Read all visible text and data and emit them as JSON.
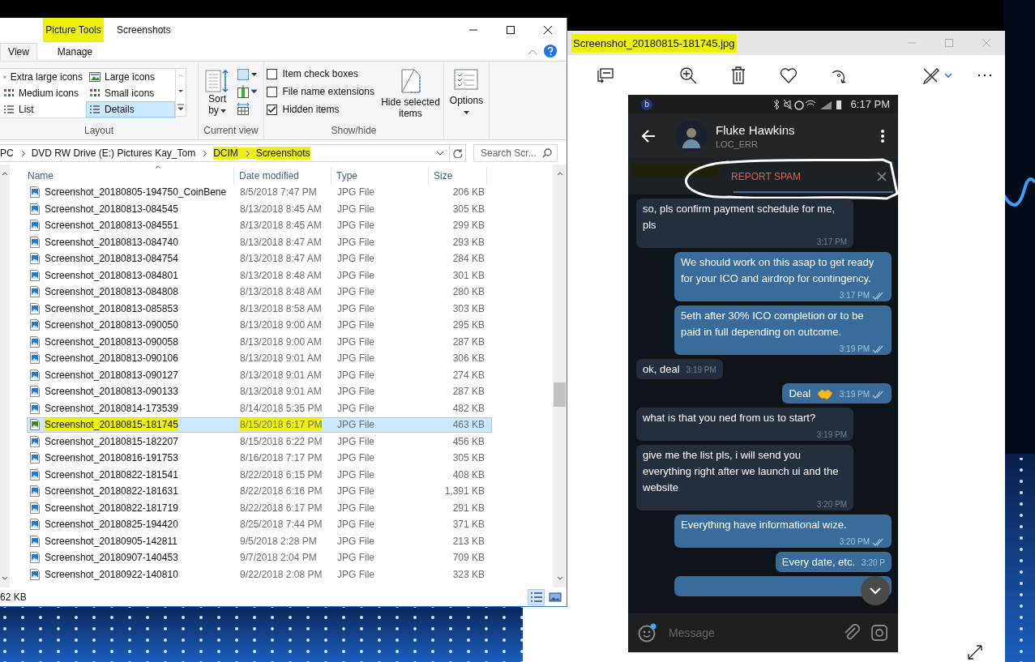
{
  "explorer": {
    "contextual_tab": {
      "label": "Picture Tools",
      "marked": true
    },
    "title": "Screenshots",
    "tabs": [
      {
        "label": "View",
        "selected": true
      },
      {
        "label": "Manage",
        "selected": false
      }
    ],
    "ribbon": {
      "layout": {
        "label": "Layout",
        "options": [
          {
            "label": "Extra large icons",
            "kind": "picture",
            "selected": false
          },
          {
            "label": "Large icons",
            "kind": "picture",
            "selected": false
          },
          {
            "label": "Medium icons",
            "kind": "grid",
            "selected": false
          },
          {
            "label": "Small icons",
            "kind": "grid",
            "selected": false
          },
          {
            "label": "List",
            "kind": "list",
            "selected": false
          },
          {
            "label": "Details",
            "kind": "list",
            "selected": true
          }
        ]
      },
      "current_view": {
        "label": "Current view",
        "sort_by": "Sort by"
      },
      "show_hide": {
        "label": "Show/hide",
        "checkboxes": [
          {
            "label": "Item check boxes",
            "checked": false
          },
          {
            "label": "File name extensions",
            "checked": false
          },
          {
            "label": "Hidden items",
            "checked": true
          }
        ],
        "hide_selected": "Hide selected items"
      },
      "options": "Options"
    },
    "address": {
      "crumbs": [
        {
          "label": "PC",
          "marked": false
        },
        {
          "label": "DVD RW Drive (E:) Pictures Kay_Tom",
          "marked": false
        },
        {
          "label": "DCIM",
          "marked": true
        },
        {
          "label": "Screenshots",
          "marked": true
        }
      ],
      "search_placeholder": "Search Scr..."
    },
    "columns": [
      "Name",
      "Date modified",
      "Type",
      "Size"
    ],
    "rows": [
      {
        "name": "Screenshot_20180805-194750_CoinBene",
        "date": "8/5/2018 7:47 PM",
        "type": "JPG File",
        "size": "206 KB",
        "selected": false,
        "marked": false
      },
      {
        "name": "Screenshot_20180813-084545",
        "date": "8/13/2018 8:45 AM",
        "type": "JPG File",
        "size": "305 KB",
        "selected": false,
        "marked": false
      },
      {
        "name": "Screenshot_20180813-084551",
        "date": "8/13/2018 8:45 AM",
        "type": "JPG File",
        "size": "299 KB",
        "selected": false,
        "marked": false
      },
      {
        "name": "Screenshot_20180813-084740",
        "date": "8/13/2018 8:47 AM",
        "type": "JPG File",
        "size": "293 KB",
        "selected": false,
        "marked": false
      },
      {
        "name": "Screenshot_20180813-084754",
        "date": "8/13/2018 8:47 AM",
        "type": "JPG File",
        "size": "284 KB",
        "selected": false,
        "marked": false
      },
      {
        "name": "Screenshot_20180813-084801",
        "date": "8/13/2018 8:48 AM",
        "type": "JPG File",
        "size": "301 KB",
        "selected": false,
        "marked": false
      },
      {
        "name": "Screenshot_20180813-084808",
        "date": "8/13/2018 8:48 AM",
        "type": "JPG File",
        "size": "280 KB",
        "selected": false,
        "marked": false
      },
      {
        "name": "Screenshot_20180813-085853",
        "date": "8/13/2018 8:58 AM",
        "type": "JPG File",
        "size": "303 KB",
        "selected": false,
        "marked": false
      },
      {
        "name": "Screenshot_20180813-090050",
        "date": "8/13/2018 9:00 AM",
        "type": "JPG File",
        "size": "295 KB",
        "selected": false,
        "marked": false
      },
      {
        "name": "Screenshot_20180813-090058",
        "date": "8/13/2018 9:00 AM",
        "type": "JPG File",
        "size": "287 KB",
        "selected": false,
        "marked": false
      },
      {
        "name": "Screenshot_20180813-090106",
        "date": "8/13/2018 9:01 AM",
        "type": "JPG File",
        "size": "306 KB",
        "selected": false,
        "marked": false
      },
      {
        "name": "Screenshot_20180813-090127",
        "date": "8/13/2018 9:01 AM",
        "type": "JPG File",
        "size": "274 KB",
        "selected": false,
        "marked": false
      },
      {
        "name": "Screenshot_20180813-090133",
        "date": "8/13/2018 9:01 AM",
        "type": "JPG File",
        "size": "287 KB",
        "selected": false,
        "marked": false
      },
      {
        "name": "Screenshot_20180814-173539",
        "date": "8/14/2018 5:35 PM",
        "type": "JPG File",
        "size": "482 KB",
        "selected": false,
        "marked": false
      },
      {
        "name": "Screenshot_20180815-181745",
        "date": "8/15/2018 6:17 PM",
        "type": "JPG File",
        "size": "463 KB",
        "selected": true,
        "marked": true
      },
      {
        "name": "Screenshot_20180815-182207",
        "date": "8/15/2018 6:22 PM",
        "type": "JPG File",
        "size": "456 KB",
        "selected": false,
        "marked": false
      },
      {
        "name": "Screenshot_20180816-191753",
        "date": "8/16/2018 7:17 PM",
        "type": "JPG File",
        "size": "305 KB",
        "selected": false,
        "marked": false
      },
      {
        "name": "Screenshot_20180822-181541",
        "date": "8/22/2018 6:15 PM",
        "type": "JPG File",
        "size": "408 KB",
        "selected": false,
        "marked": false
      },
      {
        "name": "Screenshot_20180822-181631",
        "date": "8/22/2018 6:16 PM",
        "type": "JPG File",
        "size": "1,391 KB",
        "selected": false,
        "marked": false
      },
      {
        "name": "Screenshot_20180822-181719",
        "date": "8/22/2018 6:17 PM",
        "type": "JPG File",
        "size": "291 KB",
        "selected": false,
        "marked": false
      },
      {
        "name": "Screenshot_20180825-194420",
        "date": "8/25/2018 7:44 PM",
        "type": "JPG File",
        "size": "371 KB",
        "selected": false,
        "marked": false
      },
      {
        "name": "Screenshot_20180905-142811",
        "date": "9/5/2018 2:28 PM",
        "type": "JPG File",
        "size": "213 KB",
        "selected": false,
        "marked": false
      },
      {
        "name": "Screenshot_20180907-140453",
        "date": "9/7/2018 2:04 PM",
        "type": "JPG File",
        "size": "709 KB",
        "selected": false,
        "marked": false
      },
      {
        "name": "Screenshot_20180922-140810",
        "date": "9/22/2018 2:08 PM",
        "type": "JPG File",
        "size": "323 KB",
        "selected": false,
        "marked": false
      }
    ],
    "status": "62 KB",
    "view_buttons": [
      {
        "kind": "details",
        "selected": true
      },
      {
        "kind": "large-icons",
        "selected": false
      }
    ]
  },
  "photos": {
    "title": "Screenshot_20180815-181745.jpg",
    "title_marked": true
  },
  "phone": {
    "badge": "b",
    "time": "6:17 PM",
    "contact": {
      "name": "Fluke Hawkins",
      "status": "LOC_ERR"
    },
    "report": "REPORT SPAM",
    "messages": [
      {
        "kind": "incoming",
        "text": "so, pls confirm payment schedule for me, pls",
        "time": "3:17 PM",
        "read": false
      },
      {
        "kind": "outgoing",
        "text": "We should work on this asap to get ready for your ICO and airdrop for contingency.",
        "time": "3:17 PM",
        "read": true
      },
      {
        "kind": "outgoing",
        "text": "5eth after 30% ICO completion or to be paid in full depending on outcome.",
        "time": "3:19 PM",
        "read": true
      },
      {
        "kind": "incoming",
        "text": "ok, deal",
        "time": "3:19 PM",
        "read": false
      },
      {
        "kind": "outgoing",
        "text": "Deal",
        "emoji": {
          "kind": "handshake"
        },
        "time": "3:19 PM",
        "read": true
      },
      {
        "kind": "incoming",
        "text": "what is that you ned from us to start?",
        "time": "3:19 PM",
        "read": false
      },
      {
        "kind": "incoming",
        "text": "give me the list pls, i will send you everything right after we launch ui and the website",
        "time": "3:20 PM",
        "read": false
      },
      {
        "kind": "outgoing",
        "text": "Everything have informational wize.",
        "time": "3:20 PM",
        "read": true
      },
      {
        "kind": "outgoing",
        "text": "Every date, etc.",
        "time": "3:20 P",
        "read": false
      }
    ],
    "input_placeholder": "Message"
  }
}
